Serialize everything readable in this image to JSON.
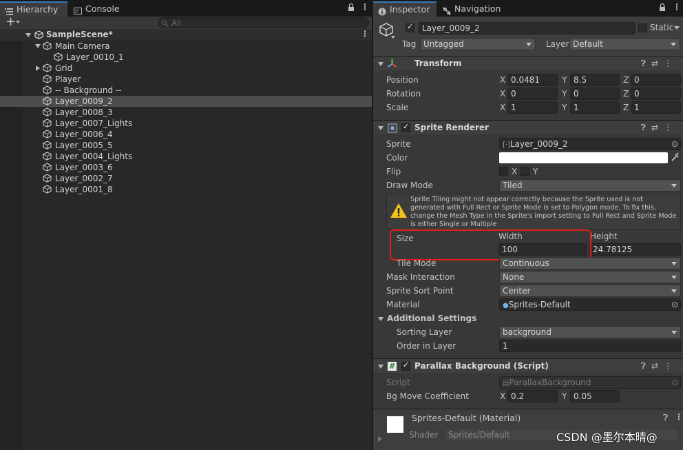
{
  "hierarchy": {
    "tab_label": "Hierarchy",
    "console_label": "Console",
    "search_placeholder": "All",
    "add_label": "+",
    "scene_name": "SampleScene*",
    "items": [
      {
        "label": "Main Camera",
        "depth": 1,
        "expandable": "open"
      },
      {
        "label": "Layer_0010_1",
        "depth": 2,
        "expandable": "none"
      },
      {
        "label": "Grid",
        "depth": 1,
        "expandable": "closed"
      },
      {
        "label": "Player",
        "depth": 1,
        "expandable": "none"
      },
      {
        "label": "-- Background --",
        "depth": 1,
        "expandable": "none"
      },
      {
        "label": "Layer_0009_2",
        "depth": 1,
        "expandable": "none",
        "selected": true
      },
      {
        "label": "Layer_0008_3",
        "depth": 1,
        "expandable": "none"
      },
      {
        "label": "Layer_0007_Lights",
        "depth": 1,
        "expandable": "none"
      },
      {
        "label": "Layer_0006_4",
        "depth": 1,
        "expandable": "none"
      },
      {
        "label": "Layer_0005_5",
        "depth": 1,
        "expandable": "none"
      },
      {
        "label": "Layer_0004_Lights",
        "depth": 1,
        "expandable": "none"
      },
      {
        "label": "Layer_0003_6",
        "depth": 1,
        "expandable": "none"
      },
      {
        "label": "Layer_0002_7",
        "depth": 1,
        "expandable": "none"
      },
      {
        "label": "Layer_0001_8",
        "depth": 1,
        "expandable": "none"
      }
    ]
  },
  "inspector": {
    "tab_label": "Inspector",
    "navigation_label": "Navigation",
    "object_name": "Layer_0009_2",
    "static_label": "Static",
    "tag_label": "Tag",
    "tag_value": "Untagged",
    "layer_label": "Layer",
    "layer_value": "Default",
    "transform": {
      "title": "Transform",
      "position_label": "Position",
      "rotation_label": "Rotation",
      "scale_label": "Scale",
      "x": "X",
      "y": "Y",
      "z": "Z",
      "position": [
        "0.0481",
        "8.5",
        "0"
      ],
      "rotation": [
        "0",
        "0",
        "0"
      ],
      "scale": [
        "1",
        "1",
        "1"
      ]
    },
    "sprite_renderer": {
      "title": "Sprite Renderer",
      "sprite_label": "Sprite",
      "sprite_value": "Layer_0009_2",
      "color_label": "Color",
      "color_value": "#ffffff",
      "flip_label": "Flip",
      "flip_x": "X",
      "flip_y": "Y",
      "draw_mode_label": "Draw Mode",
      "draw_mode_value": "Tiled",
      "warning": "Sprite Tiling might not appear correctly because the Sprite used is not generated with Full Rect or Sprite Mode is set to Polygon mode. To fix this, change the Mesh Type in the Sprite's import setting to Full Rect and Sprite Mode is either Single or Multiple",
      "size_label": "Size",
      "width_label": "Width",
      "height_label": "Height",
      "width_value": "100",
      "height_value": "24.78125",
      "tile_mode_label": "Tile Mode",
      "tile_mode_value": "Continuous",
      "mask_label": "Mask Interaction",
      "mask_value": "None",
      "sort_point_label": "Sprite Sort Point",
      "sort_point_value": "Center",
      "material_label": "Material",
      "material_value": "Sprites-Default",
      "additional_label": "Additional Settings",
      "sorting_layer_label": "Sorting Layer",
      "sorting_layer_value": "background",
      "order_label": "Order in Layer",
      "order_value": "1"
    },
    "parallax": {
      "title": "Parallax Background (Script)",
      "script_label": "Script",
      "script_value": "ParallaxBackground",
      "coef_label": "Bg Move Coefficient",
      "x": "X",
      "y": "Y",
      "x_value": "0.2",
      "y_value": "0.05"
    },
    "material": {
      "title": "Sprites-Default (Material)",
      "shader_label": "Shader",
      "shader_value": "Sprites/Default"
    }
  },
  "watermark": "CSDN @墨尔本晴@"
}
